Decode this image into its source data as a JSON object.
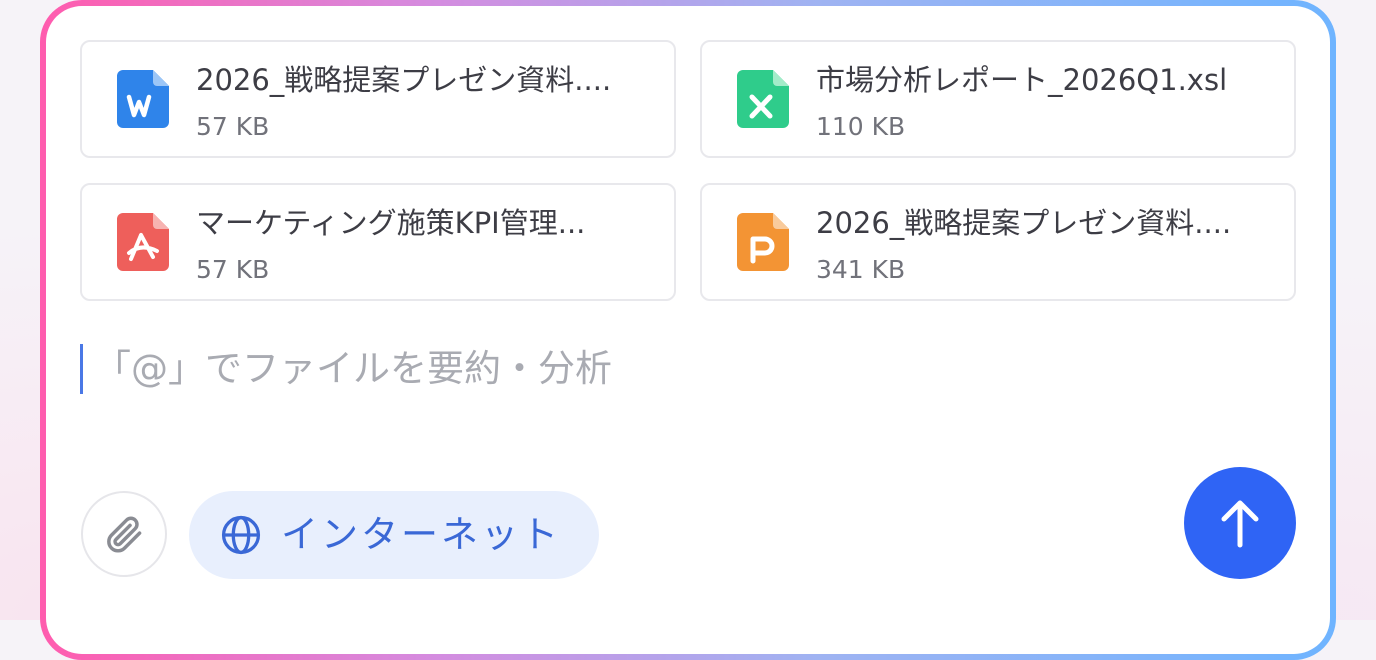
{
  "attachments": [
    {
      "name": "2026_戦略提案プレゼン資料....",
      "size": "57 KB",
      "type": "word",
      "icon": "word-file-icon",
      "color": "#2f84ea",
      "letter": "W"
    },
    {
      "name": "市場分析レポート_2026Q1.xsl",
      "size": "110 KB",
      "type": "excel",
      "icon": "excel-file-icon",
      "color": "#2fcc8b",
      "letter": "X"
    },
    {
      "name": "マーケティング施策KPI管理...",
      "size": "57 KB",
      "type": "pdf",
      "icon": "pdf-file-icon",
      "color": "#ee5f5b",
      "letter": ""
    },
    {
      "name": "2026_戦略提案プレゼン資料....",
      "size": "341 KB",
      "type": "powerpoint",
      "icon": "powerpoint-file-icon",
      "color": "#f39434",
      "letter": "P"
    }
  ],
  "input": {
    "placeholder": "「@」でファイルを要約・分析"
  },
  "toolbar": {
    "attach_icon": "paperclip-icon",
    "internet_label": "インターネット",
    "internet_icon": "globe-icon",
    "send_icon": "arrow-up-icon"
  },
  "colors": {
    "accent": "#2f64f5",
    "internet_bg": "#e8effd",
    "internet_text": "#3a68d6"
  }
}
